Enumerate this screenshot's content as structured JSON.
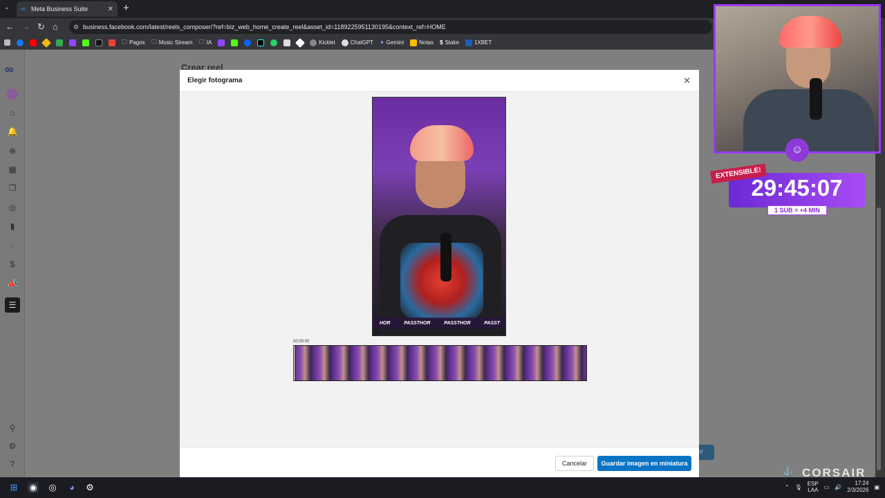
{
  "browser": {
    "tab_title": "Meta Business Suite",
    "url": "business.facebook.com/latest/reels_composer/?ref=biz_web_home_create_reel&asset_id=1189225951130195&context_ref=HOME",
    "bookmarks": [
      "Pagos",
      "Music Stream",
      "IA",
      "Kicklet",
      "ChatGPT",
      "Gemini",
      "Notas",
      "Stake",
      "1XBET"
    ]
  },
  "page": {
    "background_title": "Crear reel",
    "background_button": "nte"
  },
  "modal": {
    "title": "Elegir fotograma",
    "timecode": "00:00:00",
    "banner_text": [
      "HOR",
      "PASSTHOR",
      "PASSTHOR",
      "PASST"
    ],
    "cancel_label": "Cancelar",
    "save_label": "Guardar imagen en miniatura"
  },
  "overlay": {
    "badge": "EXTENSIBLE!",
    "timer": "29:45:07",
    "sub_rule": "1 SUB = +4 MIN",
    "brand": "CORSAIR"
  },
  "taskbar": {
    "lang_1": "ESP",
    "lang_2": "LAA",
    "time": "17:24",
    "date": "2/3/2026"
  },
  "colors": {
    "primary_button": "#0b74c4",
    "overlay_purple": "#9b38ff",
    "badge_red": "#c81e4b"
  }
}
